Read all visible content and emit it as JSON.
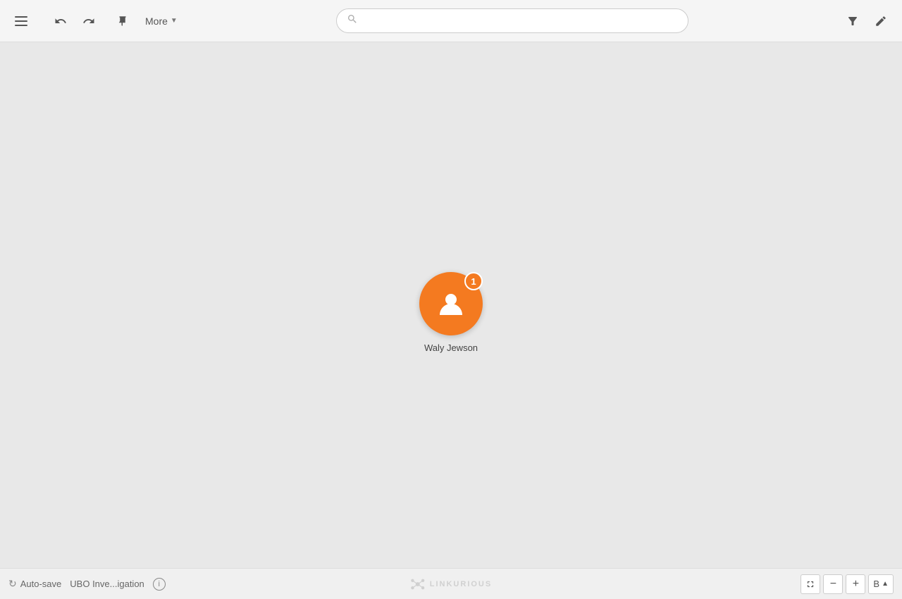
{
  "toolbar": {
    "more_label": "More",
    "search_placeholder": ""
  },
  "node": {
    "label": "Waly Jewson",
    "badge_count": "1",
    "color": "#f47a20"
  },
  "bottom": {
    "autosave_label": "Auto-save",
    "investigation_label": "UBO Inve...igation",
    "linkurious_label": "LINKURIOUS",
    "layout_label": "B",
    "zoom_minus": "−",
    "zoom_plus": "+"
  }
}
